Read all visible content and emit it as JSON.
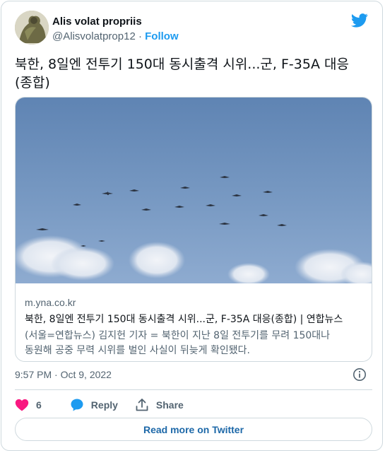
{
  "author": {
    "display_name": "Alis volat propriis",
    "handle": "@Alisvolatprop12",
    "separator": "·",
    "follow_label": "Follow"
  },
  "tweet": {
    "text_line1": "북한, 8일엔 전투기 150대 동시출격 시위...군, F-35A 대응",
    "text_line2": "(종합)"
  },
  "link_card": {
    "domain": "m.yna.co.kr",
    "title": "북한, 8일엔 전투기 150대 동시출격 시위...군, F-35A 대응(종합) | 연합뉴스",
    "description_line1": "(서울=연합뉴스) 김지헌 기자 = 북한이 지난 8일 전투기를 무려 150대나",
    "description_line2": "동원해 공중 무력 시위를 벌인 사실이 뒤늦게 확인됐다."
  },
  "timestamp": "9:57 PM · Oct 9, 2022",
  "actions": {
    "like_count": "6",
    "reply_label": "Reply",
    "share_label": "Share"
  },
  "read_more_label": "Read more on Twitter",
  "colors": {
    "twitter_blue": "#1d9bf0",
    "like_red": "#f91880",
    "read_more_blue": "#1d68a8",
    "secondary_text": "#536471"
  },
  "icons": [
    "twitter-bird-icon",
    "info-icon",
    "heart-icon",
    "reply-bubble-icon",
    "share-icon"
  ]
}
